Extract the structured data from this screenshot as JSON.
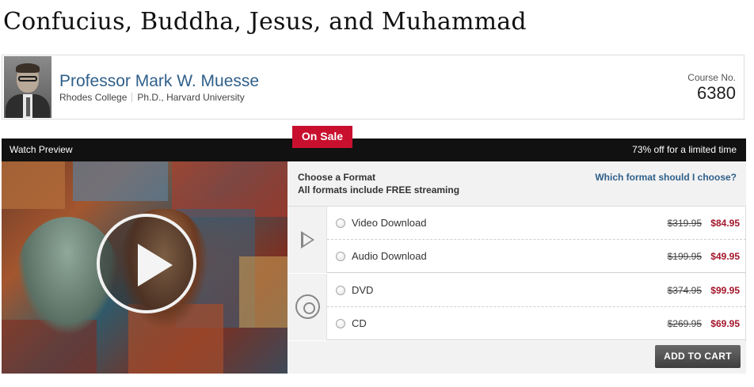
{
  "course": {
    "title": "Confucius, Buddha, Jesus, and Muhammad",
    "number_label": "Course No.",
    "number": "6380"
  },
  "professor": {
    "name": "Professor Mark W. Muesse",
    "school": "Rhodes College",
    "degree": "Ph.D., Harvard University"
  },
  "promo": {
    "on_sale_label": "On Sale",
    "watch_preview_label": "Watch Preview",
    "discount_text": "73% off for a limited time"
  },
  "formats": {
    "heading": "Choose a Format",
    "subheading": "All formats include FREE streaming",
    "help_link": "Which format should I choose?",
    "groups": [
      {
        "icon": "play-icon",
        "options": [
          {
            "label": "Video Download",
            "old_price": "$319.95",
            "sale_price": "$84.95",
            "selected": false
          },
          {
            "label": "Audio Download",
            "old_price": "$199.95",
            "sale_price": "$49.95",
            "selected": false
          }
        ]
      },
      {
        "icon": "disc-icon",
        "options": [
          {
            "label": "DVD",
            "old_price": "$374.95",
            "sale_price": "$99.95",
            "selected": false
          },
          {
            "label": "CD",
            "old_price": "$269.95",
            "sale_price": "$69.95",
            "selected": false
          }
        ]
      }
    ]
  },
  "cart": {
    "button_label": "ADD TO CART"
  },
  "colors": {
    "accent_blue": "#2f5f8a",
    "sale_red": "#c8102e",
    "price_red": "#a3152b",
    "bar_black": "#111111"
  }
}
